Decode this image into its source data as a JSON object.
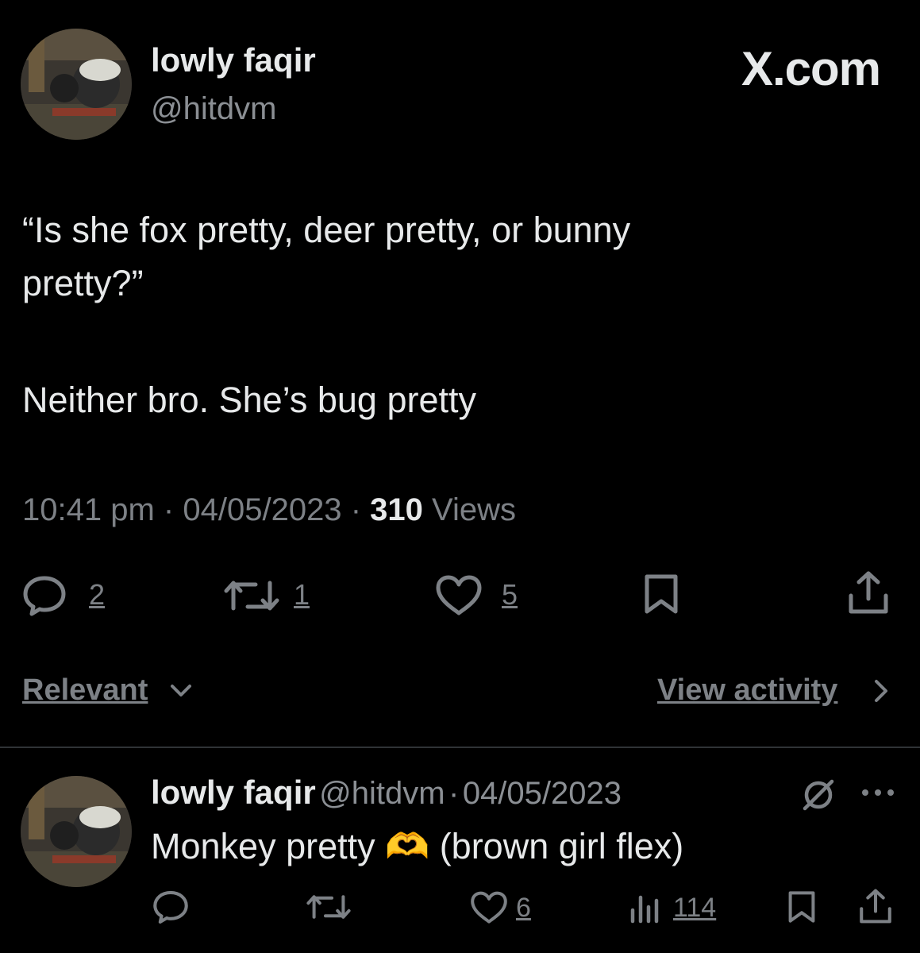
{
  "post": {
    "author_name": "lowly faqir",
    "author_handle": "@hitdvm",
    "brand": "X.com",
    "text_line1": "“Is she fox pretty, deer pretty, or bunny",
    "text_line2": "pretty?”",
    "text_line3": "Neither bro. She’s bug pretty",
    "time": "10:41 pm",
    "sep": "·",
    "date": "04/05/2023",
    "views_count": "310",
    "views_label": "Views",
    "actions": {
      "replies": "2",
      "reposts": "1",
      "likes": "5"
    }
  },
  "controls": {
    "sort_label": "Relevant",
    "view_activity_label": "View activity"
  },
  "reply": {
    "author_name": "lowly faqir",
    "author_handle": "@hitdvm",
    "sep": "·",
    "date": "04/05/2023",
    "text_before": "Monkey pretty",
    "emoji": "🫶",
    "text_after": "(brown girl flex)",
    "actions": {
      "likes": "6",
      "views": "114"
    }
  },
  "colors": {
    "background": "#000000",
    "text": "#e7e9ea",
    "secondary": "#7d8186",
    "divider": "#2f3336"
  },
  "icons": [
    "reply-icon",
    "repost-icon",
    "like-icon",
    "bookmark-icon",
    "share-icon",
    "chevron-down-icon",
    "chevron-right-icon",
    "grok-slash-icon",
    "more-icon",
    "views-icon"
  ]
}
